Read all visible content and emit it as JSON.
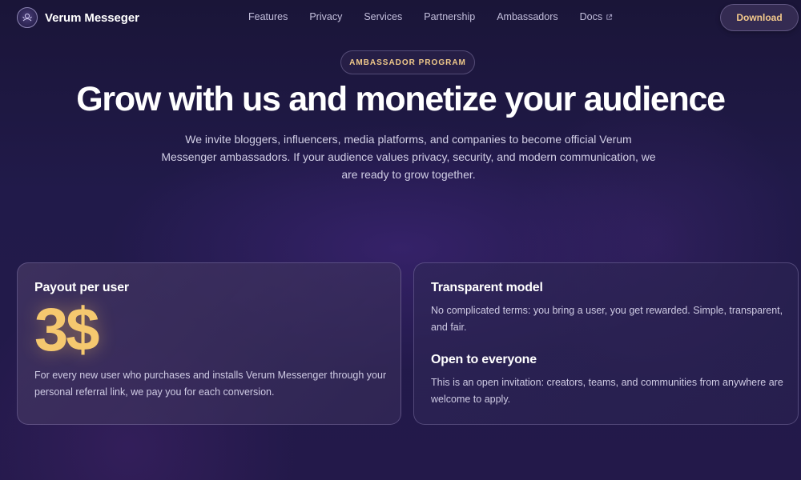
{
  "nav": {
    "brand": "Verum Messeger",
    "links": [
      "Features",
      "Privacy",
      "Services",
      "Partnership",
      "Ambassadors",
      "Docs"
    ],
    "download_label": "Download"
  },
  "hero": {
    "badge": "AMBASSADOR PROGRAM",
    "title": "Grow with us and monetize your audience",
    "description": "We invite bloggers, influencers, media platforms, and companies to become official Verum Messenger ambassadors. If your audience values privacy, security, and modern communication, we are ready to grow together."
  },
  "cards": {
    "payout": {
      "title": "Payout per user",
      "value": "3$",
      "text": "For every new user who purchases and installs Verum Messenger through your personal referral link, we pay you for each conversion."
    },
    "transparent": {
      "title": "Transparent model",
      "text": "No complicated terms: you bring a user, you get rewarded. Simple, transparent, and fair."
    },
    "open": {
      "title": "Open to everyone",
      "text": "This is an open invitation: creators, teams, and communities from anywhere are welcome to apply."
    }
  },
  "colors": {
    "accent": "#f5c86f",
    "background": "#211a4a"
  }
}
